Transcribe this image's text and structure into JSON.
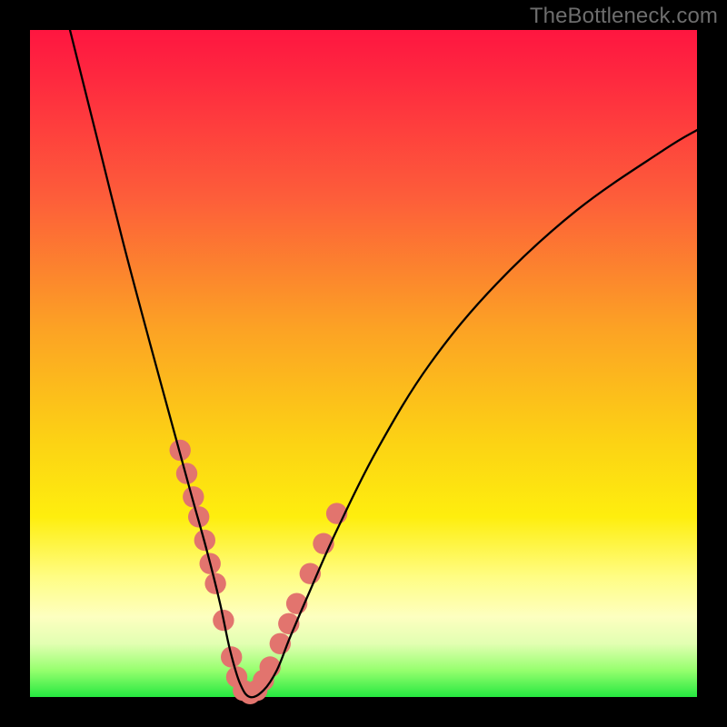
{
  "watermark": "TheBottleneck.com",
  "chart_data": {
    "type": "line",
    "title": "",
    "xlabel": "",
    "ylabel": "",
    "xlim": [
      0,
      100
    ],
    "ylim": [
      0,
      100
    ],
    "grid": false,
    "legend": false,
    "background_gradient": [
      "#fe1640",
      "#fd5d3a",
      "#fcd314",
      "#fffd84",
      "#25e840"
    ],
    "series": [
      {
        "name": "bottleneck-curve",
        "color": "#000000",
        "x": [
          6,
          10,
          14,
          18,
          21,
          24,
          26.5,
          28.5,
          30,
          31.5,
          33,
          35,
          37,
          39,
          42,
          46,
          52,
          60,
          70,
          82,
          95,
          100
        ],
        "y": [
          100,
          84,
          68,
          53,
          42,
          31,
          22,
          14,
          7,
          2,
          0,
          1,
          4,
          9,
          16,
          25,
          37,
          50,
          62,
          73,
          82,
          85
        ]
      }
    ],
    "markers": {
      "name": "highlight-dots",
      "color": "#e2746e",
      "radius_pct": 1.6,
      "points_xy": [
        [
          22.5,
          37
        ],
        [
          23.5,
          33.5
        ],
        [
          24.5,
          30
        ],
        [
          25.3,
          27
        ],
        [
          26.2,
          23.5
        ],
        [
          27,
          20
        ],
        [
          27.8,
          17
        ],
        [
          29,
          11.5
        ],
        [
          30.2,
          6
        ],
        [
          31,
          3
        ],
        [
          32,
          1
        ],
        [
          33,
          0.5
        ],
        [
          34,
          1
        ],
        [
          35,
          2.5
        ],
        [
          36,
          4.5
        ],
        [
          37.5,
          8
        ],
        [
          38.8,
          11
        ],
        [
          40,
          14
        ],
        [
          42,
          18.5
        ],
        [
          44,
          23
        ],
        [
          46,
          27.5
        ]
      ]
    }
  }
}
